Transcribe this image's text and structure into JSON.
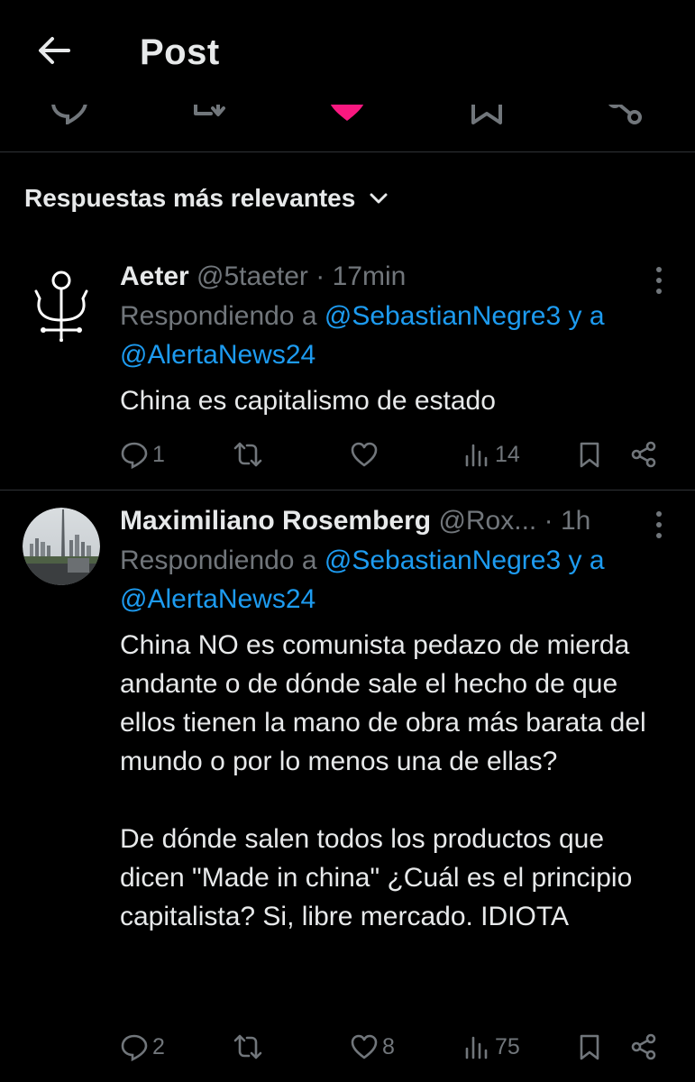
{
  "header": {
    "title": "Post",
    "back_icon": "arrow-left-icon"
  },
  "top_actions": [
    "reply-icon",
    "repost-icon",
    "like-icon",
    "bookmark-icon",
    "share-icon"
  ],
  "colors": {
    "background": "#000000",
    "text": "#e7e9ea",
    "muted": "#71767b",
    "link": "#1d9bf0",
    "like_active": "#f91880",
    "divider": "#2f3336"
  },
  "sort": {
    "label": "Respuestas más relevantes",
    "icon": "chevron-down-icon"
  },
  "replies": [
    {
      "name": "Aeter",
      "handle": "@5taeter",
      "separator": "·",
      "time": "17min",
      "replying_prefix": "Respondiendo a",
      "mention1": "@SebastianNegre3",
      "connector": "y a",
      "mention2": "@AlertaNews24",
      "text": "China es capitalismo de estado",
      "stats": {
        "replies": "1",
        "reposts": "",
        "likes": "",
        "views": "14"
      }
    },
    {
      "name": "Maximiliano Rosemberg",
      "handle": "@Rox...",
      "separator": "·",
      "time": "1h",
      "replying_prefix": "Respondiendo a",
      "mention1": "@SebastianNegre3",
      "connector": "y a",
      "mention2": "@AlertaNews24",
      "text": "China NO es comunista pedazo de mierda andante o de dónde sale el hecho de que ellos tienen la mano de obra más barata del mundo o por lo menos una de ellas?\n\nDe dónde salen todos los productos que dicen \"Made in china\" ¿Cuál es el principio capitalista? Si, libre mercado. IDIOTA",
      "stats": {
        "replies": "2",
        "reposts": "",
        "likes": "8",
        "views": "75"
      }
    }
  ]
}
